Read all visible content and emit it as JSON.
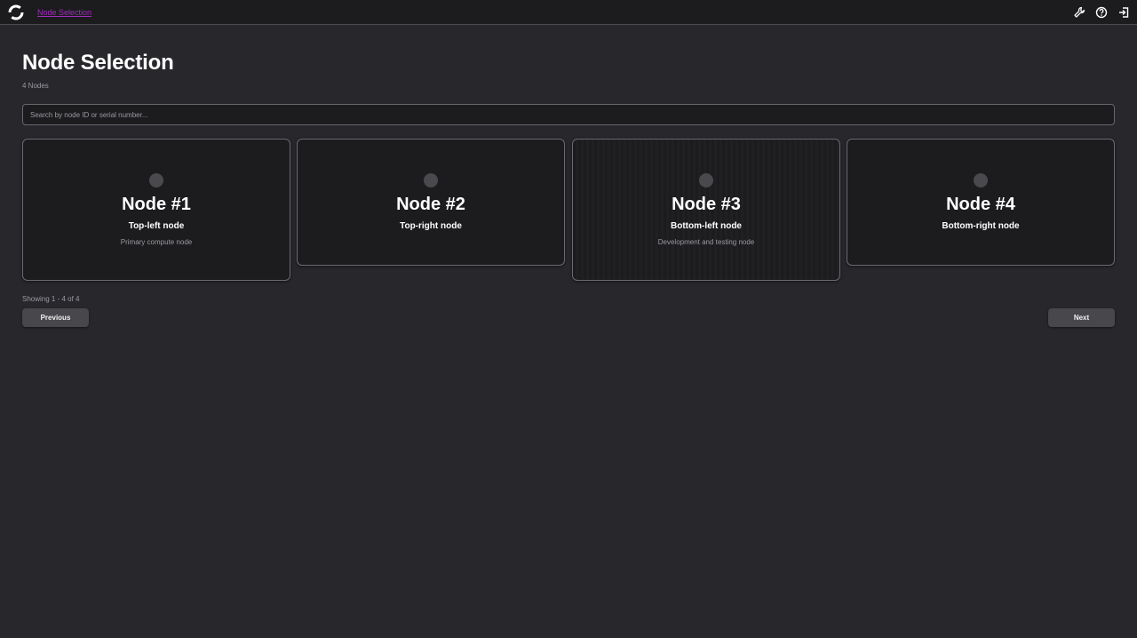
{
  "header": {
    "breadcrumb": "Node Selection",
    "icons": [
      "logo-icon",
      "wrench-icon",
      "help-icon",
      "logout-icon"
    ]
  },
  "page": {
    "title": "Node Selection",
    "count": "4 Nodes"
  },
  "search": {
    "placeholder": "Search by node ID or serial number...",
    "value": ""
  },
  "nodes": [
    {
      "title": "Node #1",
      "subtitle": "Top-left node",
      "description": "Primary compute node"
    },
    {
      "title": "Node #2",
      "subtitle": "Top-right node",
      "description": ""
    },
    {
      "title": "Node #3",
      "subtitle": "Bottom-left node",
      "description": "Development and testing node"
    },
    {
      "title": "Node #4",
      "subtitle": "Bottom-right node",
      "description": ""
    }
  ],
  "pagination": {
    "showing": "Showing 1 - 4 of 4",
    "previous_label": "Previous",
    "next_label": "Next"
  },
  "colors": {
    "background": "#28272c",
    "topbar": "#1c1c1f",
    "card": "#1c1c1f",
    "accent": "#a32bbd",
    "button": "#48484c"
  }
}
